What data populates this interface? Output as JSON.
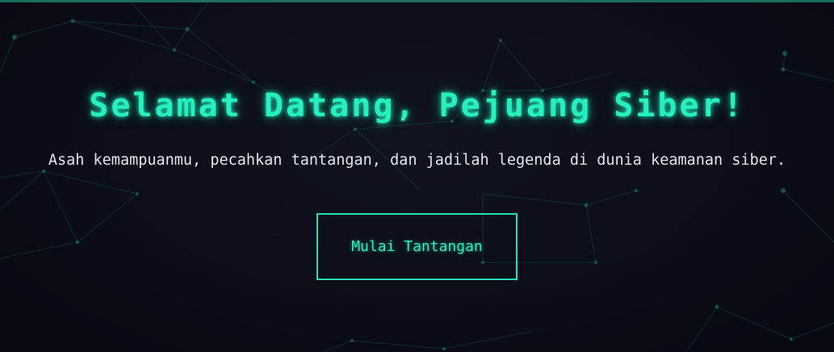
{
  "hero": {
    "title": "Selamat Datang, Pejuang Siber!",
    "subtitle": "Asah kemampuanmu, pecahkan tantangan, dan jadilah legenda di dunia keamanan siber.",
    "cta_label": "Mulai Tantangan"
  },
  "colors": {
    "background": "#0b0d16",
    "accent": "#27f0c0",
    "network": "#1c6a5a",
    "subtitle_text": "#e2e6ee"
  }
}
